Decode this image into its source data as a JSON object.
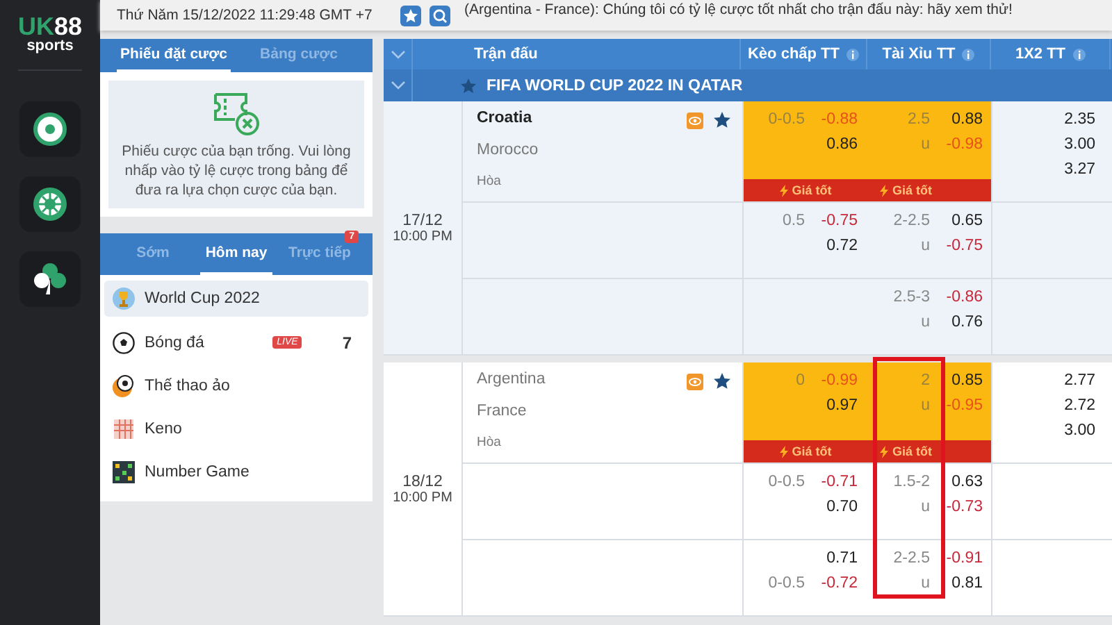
{
  "logo": {
    "parts": [
      "UK",
      "88"
    ],
    "sub": "sports"
  },
  "rail": [
    {
      "kind": "ball",
      "selected": false
    },
    {
      "kind": "wheel",
      "selected": false
    },
    {
      "kind": "clover",
      "selected": false
    }
  ],
  "topbar": {
    "datetime": "Thứ Năm 15/12/2022 11:29:48 GMT +7",
    "ticker": "(Argentina - France): Chúng tôi có tỷ lệ cược tốt nhất cho trận đấu này: hãy xem thử!"
  },
  "betslip": {
    "tabs": [
      {
        "label": "Phiếu đặt cược",
        "selected": true
      },
      {
        "label": "Bảng cược",
        "selected": false
      }
    ],
    "message": "Phiếu cược của bạn trống. Vui lòng nhấp vào tỷ lệ cược trong bảng để đưa ra lựa chọn cược của bạn."
  },
  "sports": {
    "tabs": [
      {
        "label": "Sớm",
        "selected": false
      },
      {
        "label": "Hôm nay",
        "selected": true
      },
      {
        "label": "Trực tiếp",
        "selected": false,
        "badge": "7"
      }
    ],
    "items": [
      {
        "kind": "trophy",
        "label": "World Cup 2022",
        "selected": true
      },
      {
        "kind": "ball",
        "label": "Bóng đá",
        "selected": false,
        "live": "LIVE",
        "count": "7"
      },
      {
        "kind": "virtual",
        "label": "Thế thao ảo",
        "selected": false
      },
      {
        "kind": "keno",
        "label": "Keno",
        "selected": false
      },
      {
        "kind": "grid",
        "label": "Number Game",
        "selected": false
      }
    ]
  },
  "table": {
    "columns": [
      {
        "label": "Trận đấu",
        "info": false
      },
      {
        "label": "Kèo chấp TT",
        "info": true
      },
      {
        "label": "Tài Xỉu TT",
        "info": true
      },
      {
        "label": "1X2 TT",
        "info": true
      }
    ],
    "league": "FIFA WORLD CUP 2022 IN QATAR",
    "matches": [
      {
        "date": "17/12",
        "time": "10:00 PM",
        "shaded": true,
        "outlined": false,
        "teams": [
          {
            "name": "Croatia",
            "favorite": true
          },
          {
            "name": "Morocco",
            "favorite": false
          }
        ],
        "draw": "Hòa",
        "lines": [
          {
            "best": [
              "Giá tốt",
              "Giá tốt"
            ],
            "hdp": [
              {
                "line": "0-0.5",
                "odd": "-0.88",
                "neg": true
              },
              {
                "odd": "0.86",
                "neg": false
              }
            ],
            "ou": [
              {
                "line": "2.5",
                "odd": "0.88",
                "neg": false
              },
              {
                "line": "u",
                "odd": "-0.98",
                "neg": true
              }
            ],
            "x12": [
              "2.35",
              "3.00",
              "3.27"
            ]
          },
          {
            "hdp": [
              {
                "line": "0.5",
                "odd": "-0.75",
                "neg": true
              },
              {
                "odd": "0.72",
                "neg": false
              }
            ],
            "ou": [
              {
                "line": "2-2.5",
                "odd": "0.65",
                "neg": false
              },
              {
                "line": "u",
                "odd": "-0.75",
                "neg": true
              }
            ]
          },
          {
            "ou": [
              {
                "line": "2.5-3",
                "odd": "-0.86",
                "neg": true
              },
              {
                "line": "u",
                "odd": "0.76",
                "neg": false
              }
            ]
          }
        ]
      },
      {
        "date": "18/12",
        "time": "10:00 PM",
        "shaded": false,
        "outlined": true,
        "teams": [
          {
            "name": "Argentina",
            "favorite": false
          },
          {
            "name": "France",
            "favorite": false
          }
        ],
        "draw": "Hòa",
        "lines": [
          {
            "best": [
              "Giá tốt",
              "Giá tốt"
            ],
            "hdp": [
              {
                "line": "0",
                "odd": "-0.99",
                "neg": true
              },
              {
                "odd": "0.97",
                "neg": false
              }
            ],
            "ou": [
              {
                "line": "2",
                "odd": "0.85",
                "neg": false
              },
              {
                "line": "u",
                "odd": "-0.95",
                "neg": true
              }
            ],
            "x12": [
              "2.77",
              "2.72",
              "3.00"
            ]
          },
          {
            "hdp": [
              {
                "line": "0-0.5",
                "odd": "-0.71",
                "neg": true
              },
              {
                "odd": "0.70",
                "neg": false
              }
            ],
            "ou": [
              {
                "line": "1.5-2",
                "odd": "0.63",
                "neg": false
              },
              {
                "line": "u",
                "odd": "-0.73",
                "neg": true
              }
            ]
          },
          {
            "hdp": [
              {
                "odd": "0.71",
                "neg": false
              },
              {
                "line": "0-0.5",
                "odd": "-0.72",
                "neg": true
              }
            ],
            "ou": [
              {
                "line": "2-2.5",
                "odd": "-0.91",
                "neg": true
              },
              {
                "line": "u",
                "odd": "0.81",
                "neg": false
              }
            ]
          }
        ]
      }
    ]
  }
}
